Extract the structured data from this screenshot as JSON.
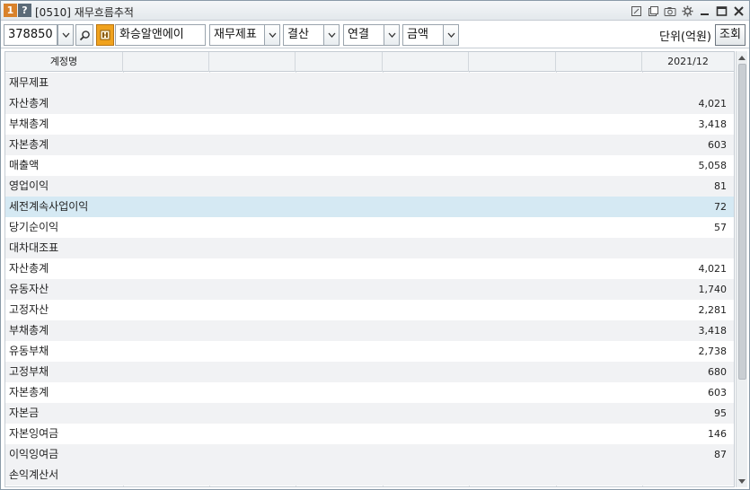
{
  "window": {
    "badge_number": "1",
    "badge_help": "?",
    "title": "[0510] 재무흐름추적"
  },
  "titlebar_icons": [
    "link-icon",
    "copy-icon",
    "camera-icon",
    "settings-icon",
    "minimize-icon",
    "maximize-icon",
    "close-icon"
  ],
  "toolbar": {
    "stock_code": "378850",
    "company_name": "화승알앤에이",
    "statement_type": "재무제표",
    "period_type": "결산",
    "consolidation": "연결",
    "value_type": "금액",
    "unit_label": "단위(억원)",
    "query_button": "조회"
  },
  "grid": {
    "header_name": "계정명",
    "header_period": "2021/12",
    "rows": [
      {
        "name": "재무제표",
        "value": "",
        "kind": "section"
      },
      {
        "name": "자산총계",
        "value": "4,021",
        "kind": "even"
      },
      {
        "name": "부채총계",
        "value": "3,418",
        "kind": "odd"
      },
      {
        "name": "자본총계",
        "value": "603",
        "kind": "even"
      },
      {
        "name": "매출액",
        "value": "5,058",
        "kind": "odd"
      },
      {
        "name": "영업이익",
        "value": "81",
        "kind": "even"
      },
      {
        "name": "세전계속사업이익",
        "value": "72",
        "kind": "hl"
      },
      {
        "name": "당기순이익",
        "value": "57",
        "kind": "odd"
      },
      {
        "name": "대차대조표",
        "value": "",
        "kind": "section"
      },
      {
        "name": "자산총계",
        "value": "4,021",
        "kind": "odd"
      },
      {
        "name": "유동자산",
        "value": "1,740",
        "kind": "even"
      },
      {
        "name": "고정자산",
        "value": "2,281",
        "kind": "odd"
      },
      {
        "name": "부채총계",
        "value": "3,418",
        "kind": "even"
      },
      {
        "name": "유동부채",
        "value": "2,738",
        "kind": "odd"
      },
      {
        "name": "고정부채",
        "value": "680",
        "kind": "even"
      },
      {
        "name": "자본총계",
        "value": "603",
        "kind": "odd"
      },
      {
        "name": "자본금",
        "value": "95",
        "kind": "even"
      },
      {
        "name": "자본잉여금",
        "value": "146",
        "kind": "odd"
      },
      {
        "name": "이익잉여금",
        "value": "87",
        "kind": "even"
      },
      {
        "name": "손익계산서",
        "value": "",
        "kind": "section"
      }
    ]
  },
  "colors": {
    "highlight_row": "#d5e9f3",
    "stripe_row": "#f1f2f4",
    "badge_orange": "#d9822b"
  }
}
